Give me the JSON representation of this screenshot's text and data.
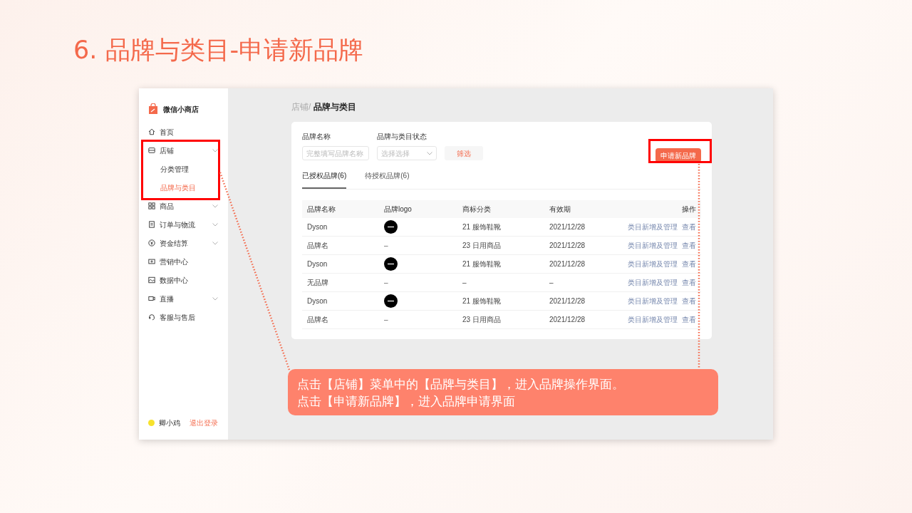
{
  "title": "6. 品牌与类目-申请新品牌",
  "sidebar": {
    "logo": "微信小商店",
    "items": [
      {
        "label": "首页",
        "has_submenu": false,
        "selected": false
      },
      {
        "label": "店铺",
        "has_submenu": true,
        "selected": false,
        "children": [
          {
            "label": "分类管理",
            "selected": false
          },
          {
            "label": "品牌与类目",
            "selected": true
          }
        ]
      },
      {
        "label": "商品",
        "has_submenu": true,
        "selected": false
      },
      {
        "label": "订单与物流",
        "has_submenu": true,
        "selected": false
      },
      {
        "label": "资金结算",
        "has_submenu": true,
        "selected": false
      },
      {
        "label": "营销中心",
        "has_submenu": false,
        "selected": false
      },
      {
        "label": "数据中心",
        "has_submenu": false,
        "selected": false
      },
      {
        "label": "直播",
        "has_submenu": true,
        "selected": false
      },
      {
        "label": "客服与售后",
        "has_submenu": false,
        "selected": false
      }
    ],
    "user": {
      "name": "卿小鸡",
      "logout": "退出登录"
    }
  },
  "breadcrumb": {
    "parent": "店铺/",
    "current": "品牌与类目"
  },
  "filters": [
    {
      "kind": "input",
      "label": "品牌名称",
      "placeholder": "完整填写品牌名称"
    },
    {
      "kind": "select",
      "label": "品牌与类目状态",
      "placeholder": "选择选择"
    }
  ],
  "filter_button": "筛选",
  "apply_button": "申请新品牌",
  "tabs": [
    {
      "label": "已授权品牌(6)",
      "selected": true
    },
    {
      "label": "待授权品牌(6)",
      "selected": false
    }
  ],
  "table": {
    "columns": [
      "品牌名称",
      "品牌logo",
      "商标分类",
      "有效期",
      "操作"
    ],
    "rows": [
      {
        "name": "Dyson",
        "logo": {
          "kind": "badge"
        },
        "category": "21 服饰鞋靴",
        "expiry": "2021/12/28",
        "actions": [
          "类目新增及管理",
          "查看"
        ]
      },
      {
        "name": "品牌名",
        "logo": {
          "kind": "none",
          "text": "–"
        },
        "category": "23 日用商品",
        "expiry": "2021/12/28",
        "actions": [
          "类目新增及管理",
          "查看"
        ]
      },
      {
        "name": "Dyson",
        "logo": {
          "kind": "badge"
        },
        "category": "21 服饰鞋靴",
        "expiry": "2021/12/28",
        "actions": [
          "类目新增及管理",
          "查看"
        ]
      },
      {
        "name": "无品牌",
        "logo": {
          "kind": "none",
          "text": "–"
        },
        "category": "–",
        "expiry": "–",
        "actions": [
          "类目新增及管理",
          "查看"
        ]
      },
      {
        "name": "Dyson",
        "logo": {
          "kind": "badge"
        },
        "category": "21 服饰鞋靴",
        "expiry": "2021/12/28",
        "actions": [
          "类目新增及管理",
          "查看"
        ]
      },
      {
        "name": "品牌名",
        "logo": {
          "kind": "none",
          "text": "–"
        },
        "category": "23 日用商品",
        "expiry": "2021/12/28",
        "actions": [
          "类目新增及管理",
          "查看"
        ]
      }
    ]
  },
  "callout": [
    "点击【店铺】菜单中的【品牌与类目】，进入品牌操作界面。",
    "点击【申请新品牌】，进入品牌申请界面"
  ]
}
